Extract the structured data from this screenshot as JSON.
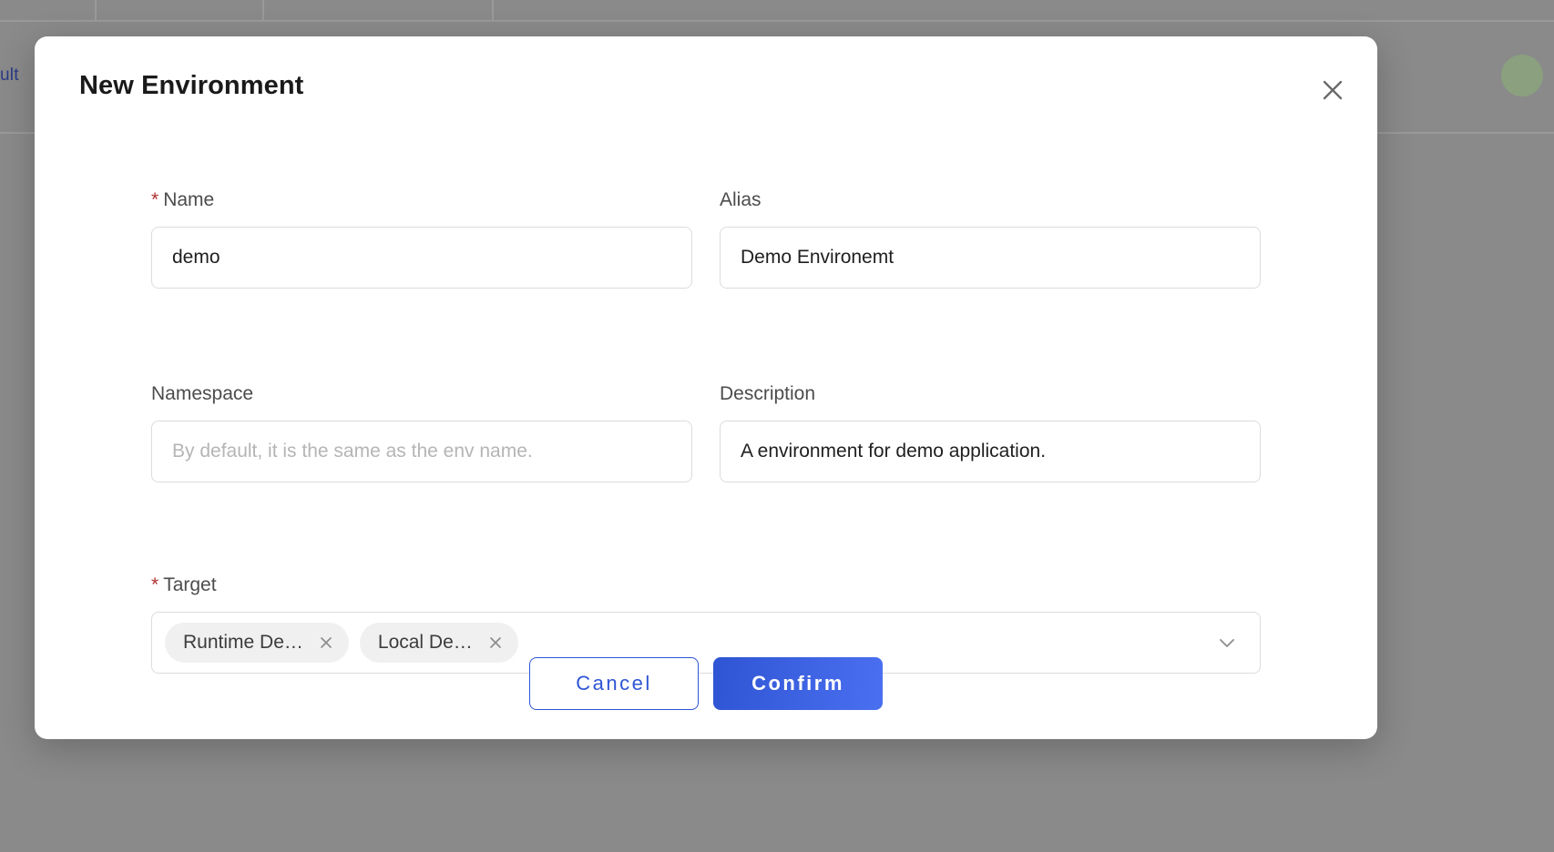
{
  "background": {
    "link_text": "ult",
    "overlay_color": "#8a8a8a",
    "grid_line_color": "#9a9a9a",
    "avatar_color": "#8aa07f"
  },
  "modal": {
    "title": "New Environment",
    "close_icon": "close-icon",
    "fields": {
      "name": {
        "label": "Name",
        "required_marker": "*",
        "value": "demo",
        "placeholder": ""
      },
      "alias": {
        "label": "Alias",
        "value": "Demo Environemt",
        "placeholder": ""
      },
      "namespace": {
        "label": "Namespace",
        "value": "",
        "placeholder": "By default, it is the same as the env name."
      },
      "description": {
        "label": "Description",
        "value": "A environment for demo application.",
        "placeholder": ""
      },
      "target": {
        "label": "Target",
        "required_marker": "*",
        "tags": [
          {
            "label": "Runtime De…",
            "remove_icon": "close-small-icon"
          },
          {
            "label": "Local De…",
            "remove_icon": "close-small-icon"
          }
        ],
        "dropdown_icon": "chevron-down-icon"
      }
    },
    "footer": {
      "cancel_label": "Cancel",
      "confirm_label": "Confirm",
      "accent_color": "#2f55d4",
      "accent_color_light": "#4a6ff0"
    }
  }
}
